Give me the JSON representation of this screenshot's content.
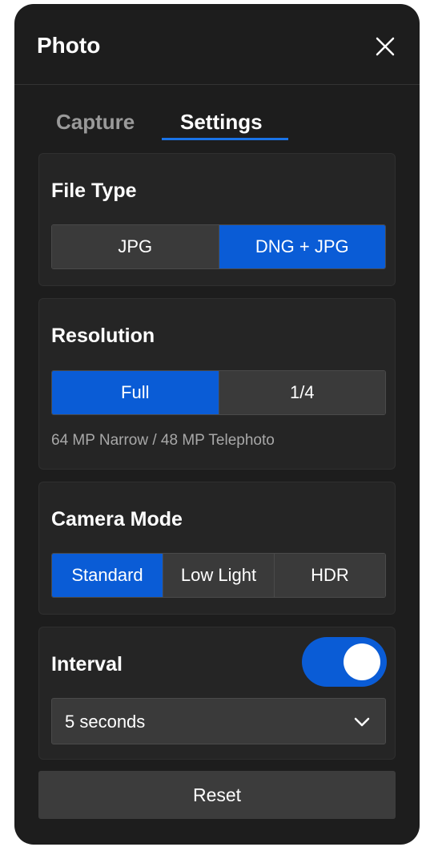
{
  "header": {
    "title": "Photo",
    "close_icon": "close-icon"
  },
  "tabs": [
    {
      "label": "Capture",
      "active": false
    },
    {
      "label": "Settings",
      "active": true
    }
  ],
  "file_type": {
    "title": "File Type",
    "options": [
      "JPG",
      "DNG + JPG"
    ],
    "selected": "DNG + JPG"
  },
  "resolution": {
    "title": "Resolution",
    "options": [
      "Full",
      "1/4"
    ],
    "selected": "Full",
    "hint": "64 MP Narrow / 48 MP Telephoto"
  },
  "camera_mode": {
    "title": "Camera Mode",
    "options": [
      "Standard",
      "Low Light",
      "HDR"
    ],
    "selected": "Standard"
  },
  "interval": {
    "title": "Interval",
    "enabled": true,
    "value": "5 seconds",
    "chevron_icon": "chevron-down-icon"
  },
  "footer": {
    "reset_label": "Reset"
  },
  "colors": {
    "accent": "#0a5cd6",
    "panel_bg": "#1d1d1d",
    "card_bg": "#252525",
    "button_bg": "#3a3a3a"
  }
}
